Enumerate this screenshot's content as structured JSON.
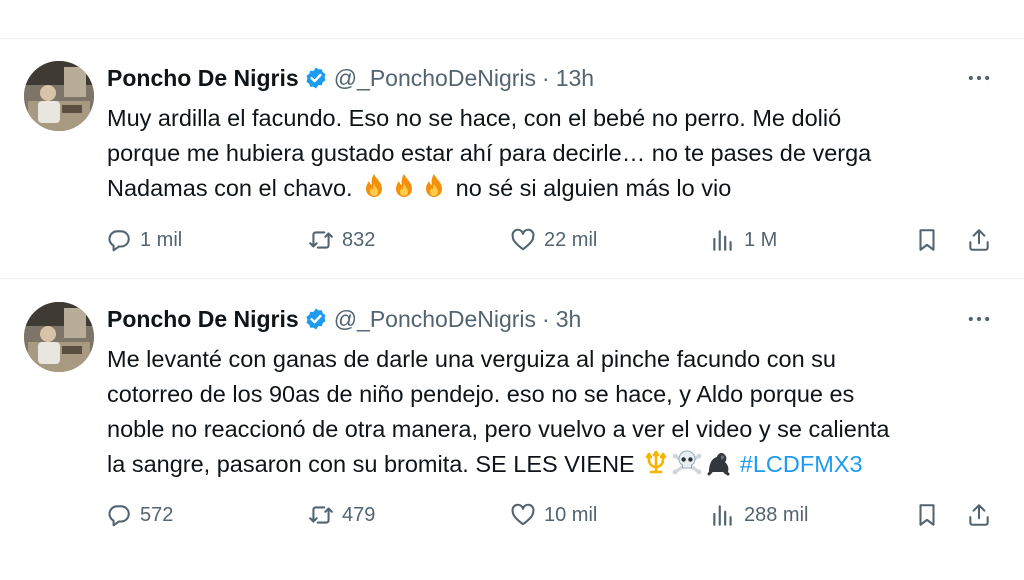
{
  "tweets": [
    {
      "author_name": "Poncho De Nigris",
      "handle": "@_PonchoDeNigris",
      "separator": "·",
      "time": "13h",
      "text_lines": [
        "Muy ardilla el facundo. Eso no se hace, con el bebé no perro. Me dolió",
        "porque me hubiera gustado estar ahí para decirle… no te pases de verga",
        "Nadamas con el chavo."
      ],
      "text_tail": "no sé si alguien más lo vio",
      "emojis": [
        "fire-emoji",
        "fire-emoji",
        "fire-emoji"
      ],
      "replies": "1 mil",
      "reposts": "832",
      "likes": "22 mil",
      "views": "1 M"
    },
    {
      "author_name": "Poncho De Nigris",
      "handle": "@_PonchoDeNigris",
      "separator": "·",
      "time": "3h",
      "text_lines": [
        "Me levanté con ganas de darle una verguiza al pinche facundo con su",
        "cotorreo de los 90as de niño pendejo. eso no se hace,  y Aldo porque es",
        "noble no reaccionó de otra manera, pero vuelvo a ver el video y se calienta",
        "la sangre, pasaron con su bromita. SE LES VIENE"
      ],
      "emojis": [
        "trident-emoji",
        "skull-crossbones-emoji",
        "gorilla-emoji"
      ],
      "hashtag": "#LCDFMX3",
      "replies": "572",
      "reposts": "479",
      "likes": "10 mil",
      "views": "288 mil"
    }
  ],
  "colors": {
    "text": "#0f1419",
    "secondary": "#536471",
    "verified": "#1d9bf0",
    "hashtag": "#1d9bf0",
    "divider": "#eff3f4"
  },
  "icons": [
    "verified-badge-icon",
    "more-icon",
    "reply-icon",
    "repost-icon",
    "like-icon",
    "views-icon",
    "bookmark-icon",
    "share-icon"
  ]
}
